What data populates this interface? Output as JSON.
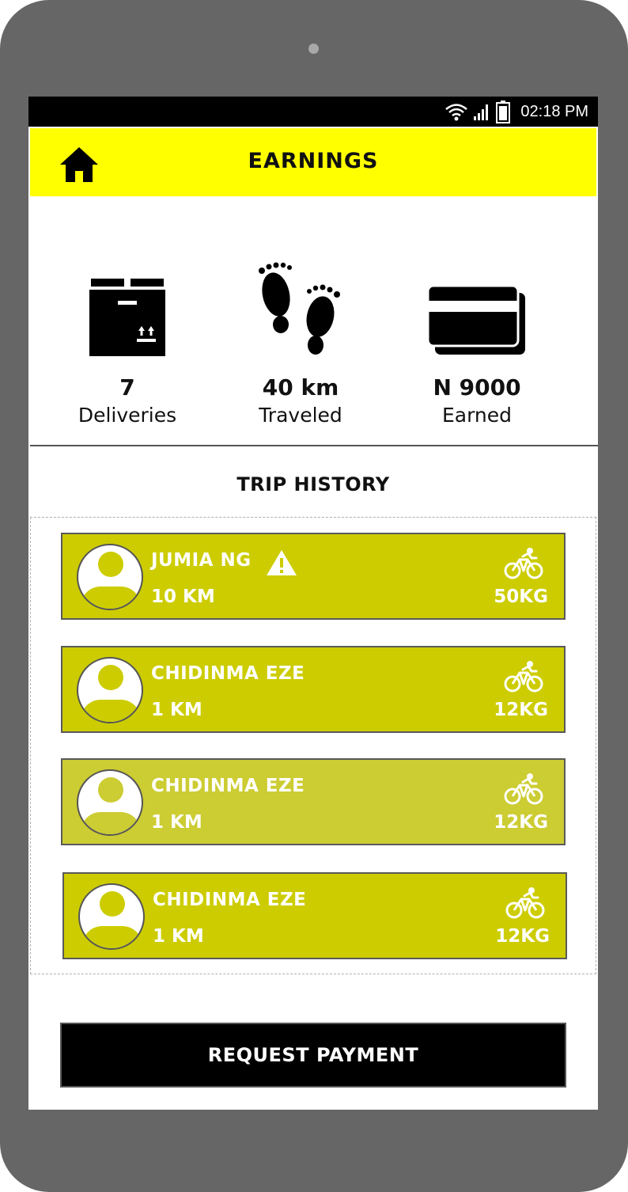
{
  "status_bar": {
    "time": "02:18 PM",
    "icons": [
      "wifi-icon",
      "signal-icon",
      "battery-icon"
    ]
  },
  "header": {
    "title": "EARNINGS",
    "home_icon": "home-icon",
    "background_color": "#ffff00"
  },
  "stats": [
    {
      "icon": "package-box-icon",
      "value": "7",
      "label": "Deliveries"
    },
    {
      "icon": "footprints-icon",
      "value": "40 km",
      "label": "Traveled"
    },
    {
      "icon": "credit-card-icon",
      "value": "N 9000",
      "label": "Earned"
    }
  ],
  "trip_history": {
    "title": "TRIP HISTORY",
    "trips": [
      {
        "name": "JUMIA NG",
        "distance": "10 KM",
        "weight": "50KG",
        "warning": true,
        "color": "#cccc00"
      },
      {
        "name": "CHIDINMA EZE",
        "distance": "1 KM",
        "weight": "12KG",
        "warning": false,
        "color": "#cccc00"
      },
      {
        "name": "CHIDINMA EZE",
        "distance": "1 KM",
        "weight": "12KG",
        "warning": false,
        "color": "#cccc33"
      },
      {
        "name": "CHIDINMA EZE",
        "distance": "1 KM",
        "weight": "12KG",
        "warning": false,
        "color": "#cccc00"
      }
    ]
  },
  "request_payment_label": "REQUEST PAYMENT"
}
